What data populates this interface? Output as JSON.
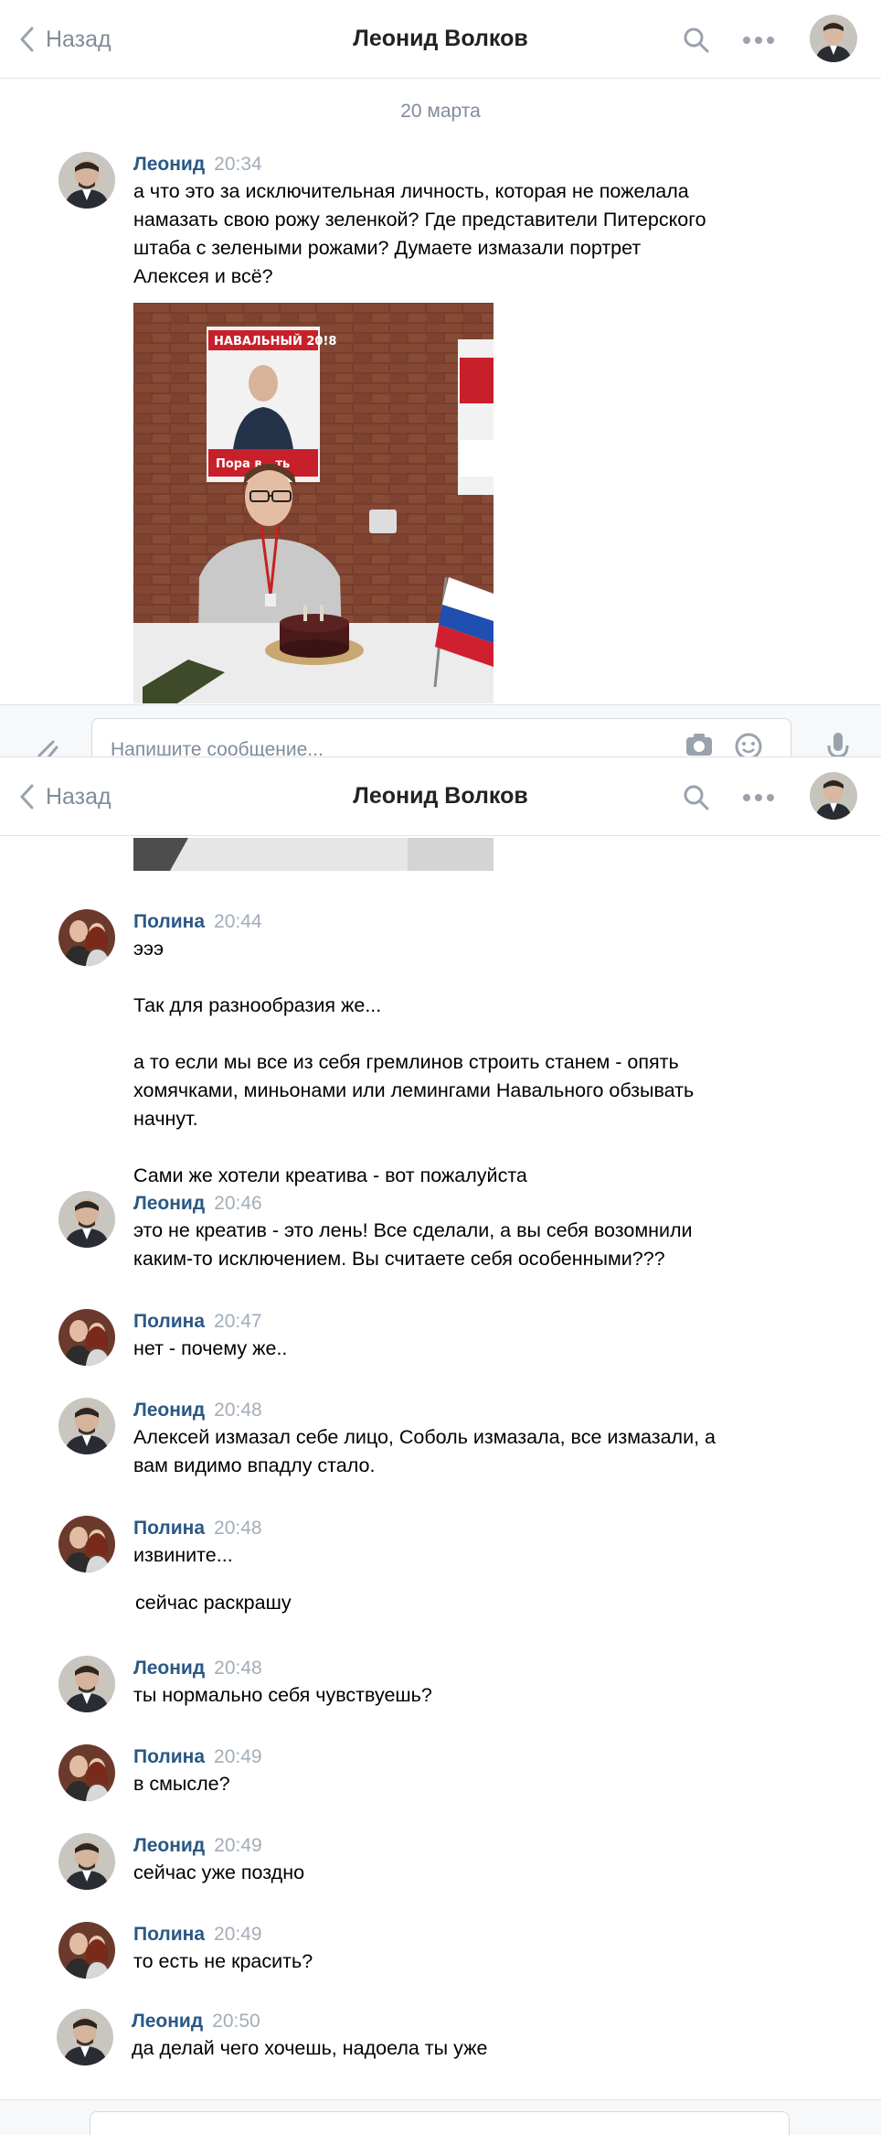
{
  "header": {
    "back_label": "Назад",
    "title": "Леонид Волков"
  },
  "date_separator": "20 марта",
  "composer": {
    "placeholder": "Напишите сообщение..."
  },
  "messages": [
    {
      "author": "Леонид",
      "time": "20:34",
      "text": "а что это за исключительная личность, которая не пожелала\nнамазать свою рожу зеленкой? Где представители Питерского\nштаба с зелеными рожами? Думаете измазали портрет\nАлексея и всё?"
    },
    {
      "author": "Полина",
      "time": "20:44",
      "text": "эээ\n\nТак для разнообразия же...\n\nа то если мы все из себя гремлинов строить станем - опять\nхомячками, миньонами или лемингами Навального обзывать\nначнут.\n\nСами же хотели креатива - вот пожалуйста"
    },
    {
      "author": "Леонид",
      "time": "20:46",
      "text": "это не креатив - это лень! Все сделали, а вы себя возомнили\nкаким-то исключением. Вы считаете себя особенными???"
    },
    {
      "author": "Полина",
      "time": "20:47",
      "text": "нет - почему же.."
    },
    {
      "author": "Леонид",
      "time": "20:48",
      "text": "Алексей измазал себе лицо, Соболь измазала, все измазали, а\nвам видимо впадлу стало."
    },
    {
      "author": "Полина",
      "time": "20:48",
      "text": "извините..."
    },
    {
      "follow_text": "сейчас раскрашу"
    },
    {
      "author": "Леонид",
      "time": "20:48",
      "text": "ты нормально себя чувствуешь?"
    },
    {
      "author": "Полина",
      "time": "20:49",
      "text": "в смысле?"
    },
    {
      "author": "Леонид",
      "time": "20:49",
      "text": "сейчас уже поздно"
    },
    {
      "author": "Полина",
      "time": "20:49",
      "text": "то есть не красить?"
    },
    {
      "author": "Леонид",
      "time": "20:50",
      "text": "да делай чего хочешь, надоела ты уже"
    }
  ],
  "photo_poster": {
    "text_top": "НАВАЛЬНЫЙ 20!8",
    "text_bottom": "Пора в...ть"
  },
  "colors": {
    "accent": "#2a5885",
    "muted": "#818c99",
    "time": "#a3adb8"
  }
}
